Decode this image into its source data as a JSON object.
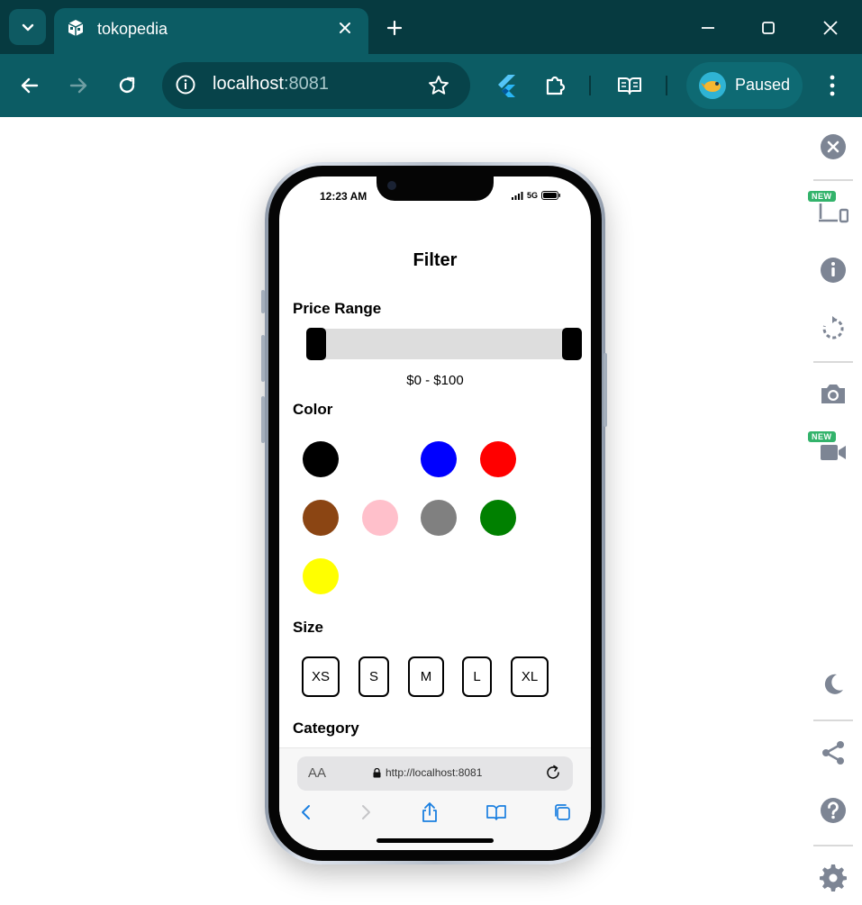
{
  "browser": {
    "tab_title": "tokopedia",
    "url_host": "localhost",
    "url_port": ":8081",
    "profile_label": "Paused"
  },
  "sidepanel": {
    "new_badge_1": "NEW",
    "new_badge_2": "NEW"
  },
  "phone": {
    "status_time": "12:23 AM",
    "status_network": "5G",
    "page_title": "Filter",
    "price_section_label": "Price Range",
    "price_range_text": "$0 - $100",
    "price_min_fraction": 0,
    "price_max_fraction": 1,
    "color_section_label": "Color",
    "colors": [
      "#000000",
      "#ffffff",
      "#0000ff",
      "#ff0000",
      "#8b4513",
      "#ffc0cb",
      "#808080",
      "#008000",
      "#ffff00"
    ],
    "size_section_label": "Size",
    "sizes": [
      "XS",
      "S",
      "M",
      "L",
      "XL"
    ],
    "category_section_label": "Category",
    "safari_aa": "AA",
    "safari_url": "http://localhost:8081"
  },
  "theme": {
    "chrome_dark": "#063a40",
    "chrome_toolbar": "#0c5c64",
    "accent_new": "#33b36b",
    "safari_blue": "#1a7fe0"
  }
}
